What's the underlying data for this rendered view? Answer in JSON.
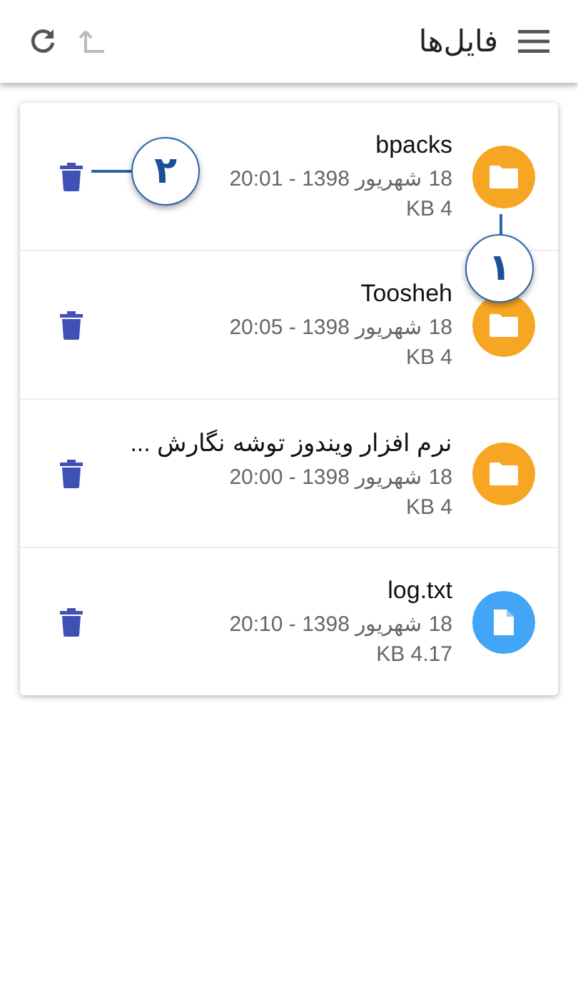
{
  "app_bar": {
    "title": "فایل‌ها"
  },
  "files": [
    {
      "kind": "folder",
      "name": "bpacks",
      "date": "18 شهریور 1398 - 20:01",
      "size": "4 KB"
    },
    {
      "kind": "folder",
      "name": "Toosheh",
      "date": "18 شهریور 1398 - 20:05",
      "size": "4 KB"
    },
    {
      "kind": "folder",
      "name": "نرم افزار ویندوز توشه نگارش ...",
      "date": "18 شهریور 1398 - 20:00",
      "size": "4 KB"
    },
    {
      "kind": "file",
      "name": "log.txt",
      "date": "18 شهریور 1398 - 20:10",
      "size": "4.17 KB"
    }
  ],
  "callouts": [
    {
      "label": "۱"
    },
    {
      "label": "۲"
    }
  ]
}
